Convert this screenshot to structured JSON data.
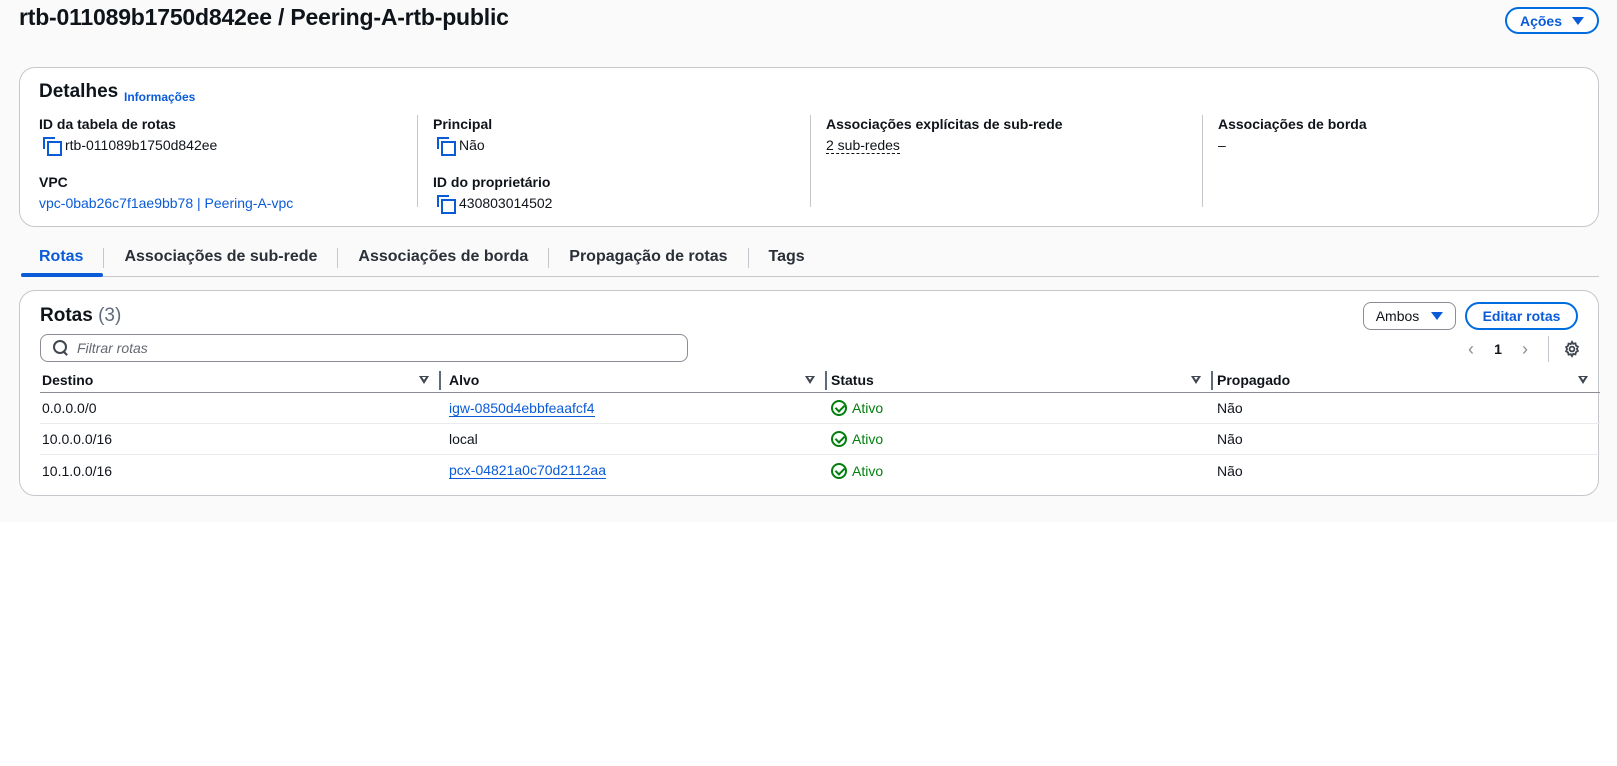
{
  "header": {
    "title": "rtb-011089b1750d842ee / Peering-A-rtb-public",
    "actions_label": "Ações"
  },
  "details": {
    "title": "Detalhes",
    "info_link": "Informações",
    "route_table_id": {
      "label": "ID da tabela de rotas",
      "value": "rtb-011089b1750d842ee"
    },
    "vpc": {
      "label": "VPC",
      "value": "vpc-0bab26c7f1ae9bb78 | Peering-A-vpc"
    },
    "main": {
      "label": "Principal",
      "value": "Não"
    },
    "owner_id": {
      "label": "ID do proprietário",
      "value": "430803014502"
    },
    "explicit_subnet_assoc": {
      "label": "Associações explícitas de sub-rede",
      "value": "2 sub-redes"
    },
    "edge_assoc": {
      "label": "Associações de borda",
      "value": "–"
    }
  },
  "tabs": [
    {
      "label": "Rotas",
      "active": true
    },
    {
      "label": "Associações de sub-rede",
      "active": false
    },
    {
      "label": "Associações de borda",
      "active": false
    },
    {
      "label": "Propagação de rotas",
      "active": false
    },
    {
      "label": "Tags",
      "active": false
    }
  ],
  "routes": {
    "title": "Rotas",
    "count": "(3)",
    "filter_select": "Ambos",
    "edit_button": "Editar rotas",
    "search_placeholder": "Filtrar rotas",
    "page": "1",
    "columns": [
      "Destino",
      "Alvo",
      "Status",
      "Propagado"
    ],
    "rows": [
      {
        "destination": "0.0.0.0/0",
        "target": "igw-0850d4ebbfeaafcf4",
        "target_is_link": true,
        "status": "Ativo",
        "propagated": "Não"
      },
      {
        "destination": "10.0.0.0/16",
        "target": "local",
        "target_is_link": false,
        "status": "Ativo",
        "propagated": "Não"
      },
      {
        "destination": "10.1.0.0/16",
        "target": "pcx-04821a0c70d2112aa",
        "target_is_link": true,
        "status": "Ativo",
        "propagated": "Não"
      }
    ]
  },
  "colors": {
    "accent": "#0a5bd8",
    "success": "#037f0c",
    "border": "#c6c6cd"
  },
  "icons": [
    "copy-icon",
    "search-icon",
    "chevron-left-icon",
    "chevron-right-icon",
    "gear-icon",
    "check-circle-icon",
    "caret-down-icon",
    "sort-icon"
  ]
}
